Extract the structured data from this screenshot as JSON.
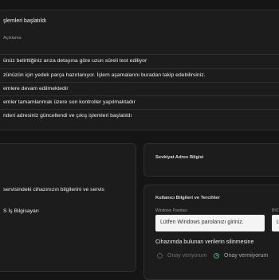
{
  "status": {
    "title": "şlemleri başlatıldı",
    "column_header": "Açıklama",
    "rows": [
      "ünüz belirttiğiniz arıza detayına göre uzun süreli test ediliyor",
      "zünüzün için yedek parça hazırlanıyor. İşlem aşamalarını buradan takip edebilirsiniz.",
      "emlere devam edilmektedir",
      "emler tamamlanmak üzere son kontroller yapılmaktadır",
      "nderi adresiniz güncellendi ve çıkış işlemleri başlatıldı"
    ]
  },
  "device": {
    "line1": "servisindeki cihazınızın bilgilerini ve servis",
    "line2": "S İş Bilgisayarı"
  },
  "shipping": {
    "title": "Sevkiyat Adres Bilgisi"
  },
  "credentials": {
    "title": "Kullanıcı Bilgileri ve Tercihler",
    "password_label": "Windows Parolası",
    "password_placeholder": "Lütfen Windows parolanızı giriniz.",
    "second_label": "BIO",
    "second_placeholder": "L",
    "wipe_question": "Cihazımda bulunan verilerin silinmesine",
    "options": [
      {
        "label": "Onay veriyorum",
        "selected": false
      },
      {
        "label": "Onay vermiyorum",
        "selected": true
      }
    ]
  },
  "colors": {
    "accent": "#37b06a",
    "background": "#151515",
    "panel": "#1c1c1c"
  }
}
